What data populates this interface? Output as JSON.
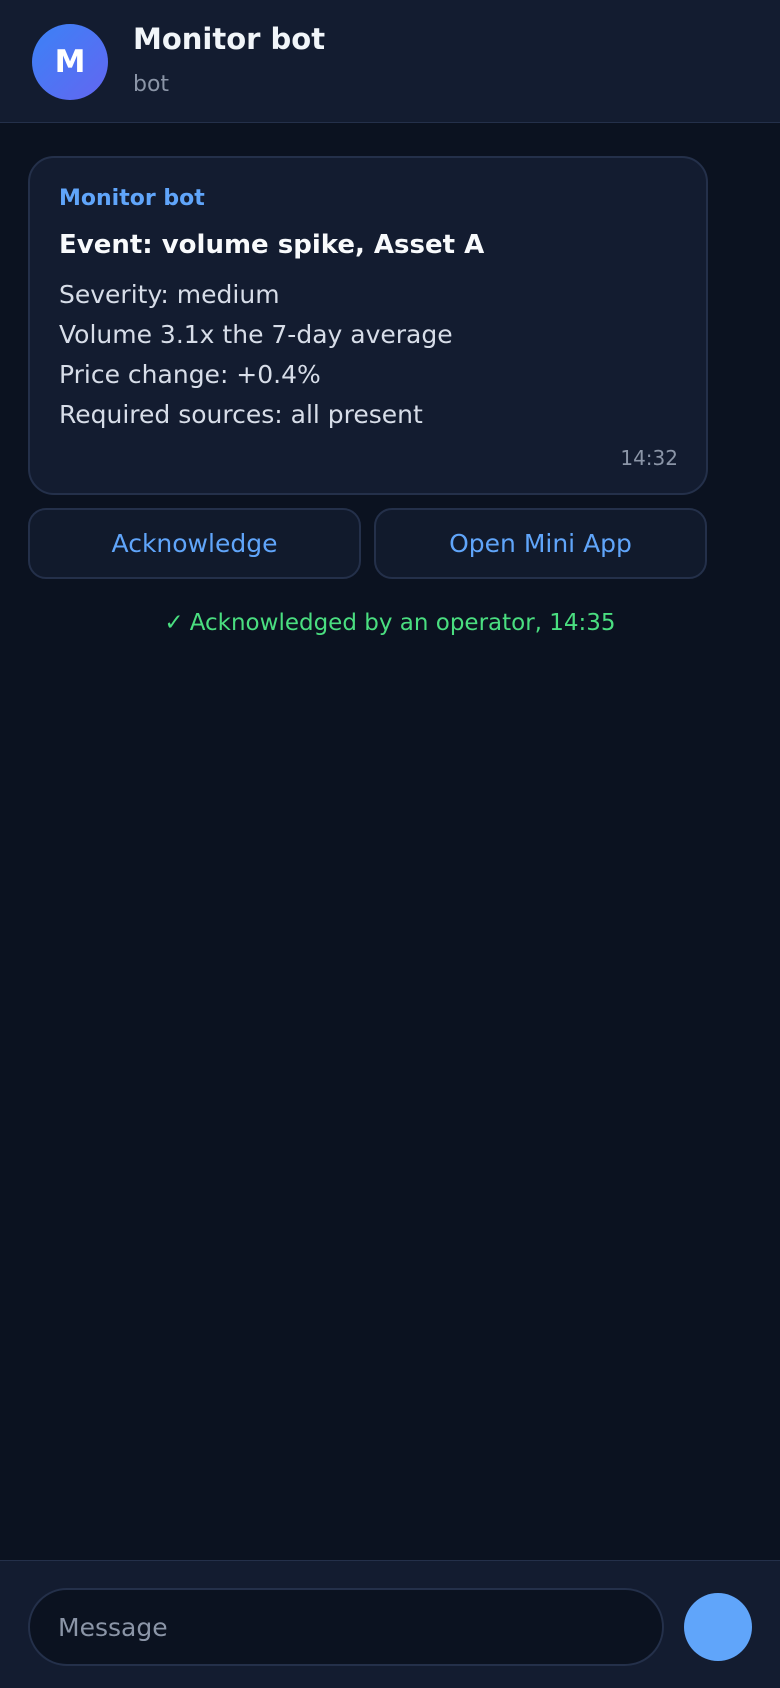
{
  "header": {
    "avatar_initial": "M",
    "title": "Monitor bot",
    "subtitle": "bot"
  },
  "message": {
    "sender": "Monitor bot",
    "title": "Event: volume spike, Asset A",
    "lines": [
      "Severity: medium",
      "Volume 3.1x the 7-day average",
      "Price change: +0.4%",
      "Required sources: all present"
    ],
    "time": "14:32"
  },
  "buttons": {
    "acknowledge": "Acknowledge",
    "open_mini_app": "Open Mini App"
  },
  "status": {
    "check": "✓",
    "text": "Acknowledged by an operator, 14:35"
  },
  "composer": {
    "placeholder": "Message"
  },
  "colors": {
    "background": "#0b1220",
    "header_background": "#131c30",
    "accent": "#60a5fa",
    "success": "#4ade80"
  }
}
